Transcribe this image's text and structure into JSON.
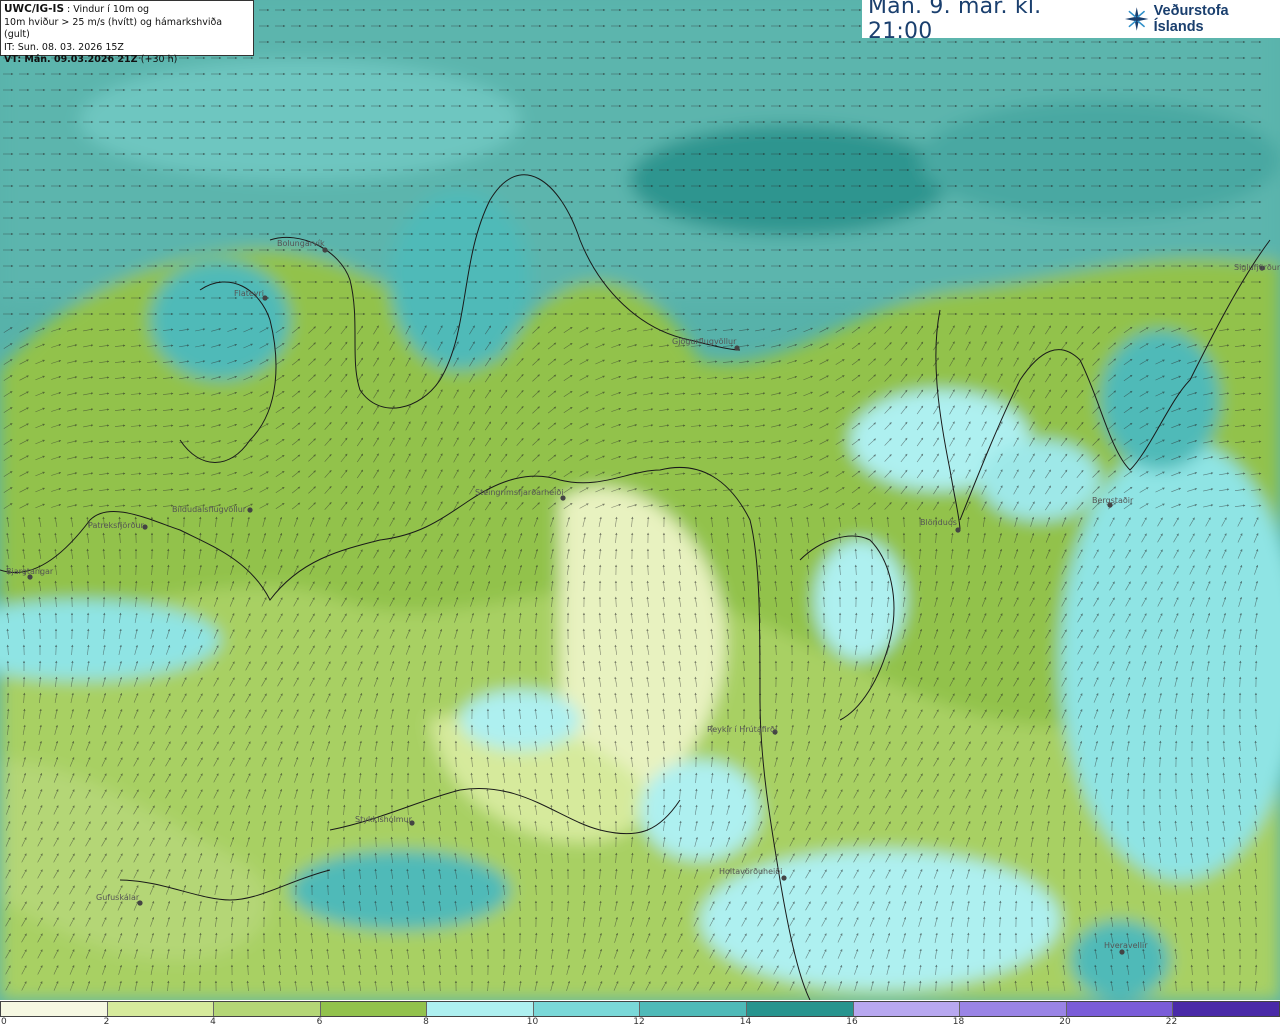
{
  "info": {
    "model": "UWC/IG-IS",
    "desc1": ": Vindur í 10m og",
    "desc2": "10m hviður > 25 m/s (hvítt) og hámarkshviða (gult)",
    "init_time": "IT: Sun. 08. 03. 2026 15Z",
    "valid_time": "VT: Mán. 09.03.2026 21Z",
    "offset": "(+30 h)"
  },
  "header": {
    "time_label": "Mán. 9. mar. kl. 21:00",
    "logo_text": "Veðurstofa Íslands",
    "logo_icon": "vedurstofa-star-logo"
  },
  "legend": {
    "ticks": [
      "0",
      "2",
      "4",
      "6",
      "8",
      "10",
      "12",
      "14",
      "16",
      "18",
      "20",
      "22"
    ],
    "colors": [
      "#f6f8e2",
      "#d6ea9c",
      "#b4d676",
      "#92c24c",
      "#aef0f0",
      "#7ad8d8",
      "#4fbab8",
      "#27948e",
      "#b8a8f0",
      "#9a84e6",
      "#7a5cd8",
      "#4a2aa8"
    ]
  },
  "stations": [
    {
      "name": "Bolungarvík"
    },
    {
      "name": "Flateyri"
    },
    {
      "name": "Gjögurflugvöllur"
    },
    {
      "name": "Siglufjörður"
    },
    {
      "name": "Steingrímsfjarðarheiði"
    },
    {
      "name": "Patreksfjörður"
    },
    {
      "name": "Bíldudalsflugvöllur"
    },
    {
      "name": "Bjargtangar"
    },
    {
      "name": "Blönduós"
    },
    {
      "name": "Bergstaðir"
    },
    {
      "name": "Reykir í Hrútafirði"
    },
    {
      "name": "Stykkishólmur"
    },
    {
      "name": "Holtavörðuheiði"
    },
    {
      "name": "Gufuskálar"
    },
    {
      "name": "Hveravellir"
    }
  ]
}
